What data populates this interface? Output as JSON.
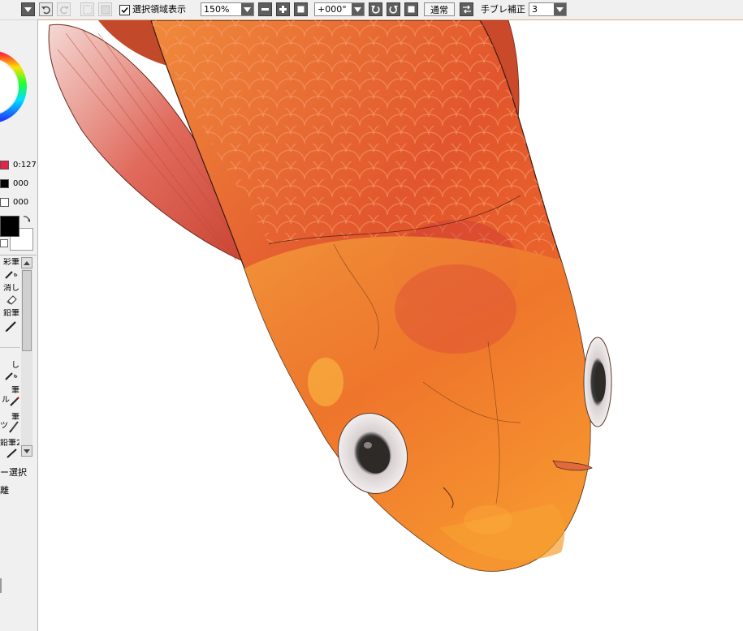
{
  "toolbar": {
    "selection_checkbox_label": "選択領域表示",
    "selection_checked": true,
    "zoom_value": "150%",
    "rotation_value": "+000°",
    "blend_mode_label": "通常",
    "stabilizer_label": "手ブレ補正",
    "stabilizer_value": "3"
  },
  "left_panel": {
    "color_values": [
      {
        "label": "0:127",
        "color": "#e8204a"
      },
      {
        "label": "000",
        "color": "#000000"
      },
      {
        "label": "000",
        "color": "#ffffff"
      }
    ],
    "primary_color": "#000000",
    "secondary_color": "#ffffff",
    "tools": [
      "彩筆",
      "消し",
      "鉛筆",
      "し",
      "筆",
      "ル",
      "筆",
      "ツ",
      "鉛筆2"
    ],
    "selection_label": "ー選択",
    "misc_label": "離"
  },
  "canvas": {
    "background": "#ffffff",
    "subject": "goldfish-illustration"
  }
}
